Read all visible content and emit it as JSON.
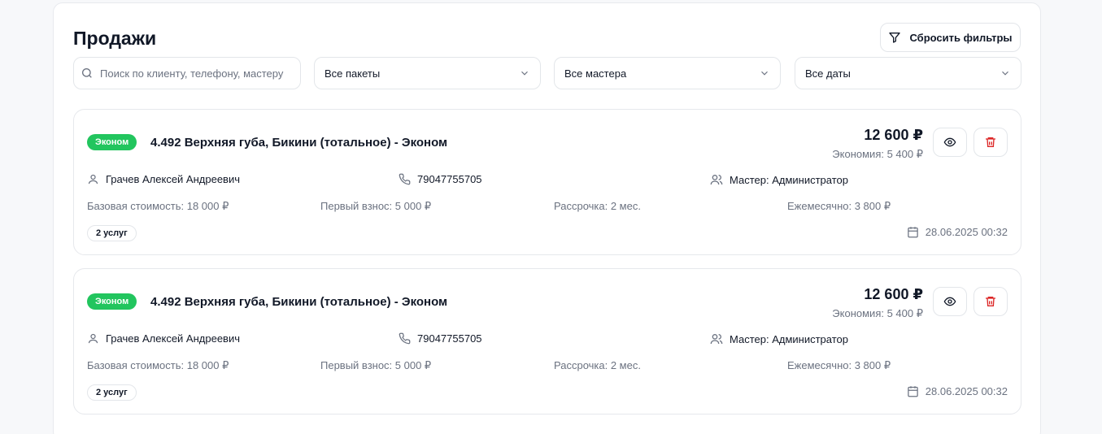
{
  "page": {
    "title": "Продажи"
  },
  "toolbar": {
    "reset_label": "Сбросить фильтры",
    "reset_icon": "filter-icon"
  },
  "filters": {
    "search_placeholder": "Поиск по клиенту, телефону, мастеру",
    "package_selected": "Все пакеты",
    "master_selected": "Все мастера",
    "date_selected": "Все даты"
  },
  "colors": {
    "accent_green": "#22c55e",
    "danger_red": "#dc2626"
  },
  "sales": [
    {
      "badge": "Эконом",
      "title": "4.492 Верхняя губа, Бикини (тотальное) - Эконом",
      "price": "12 600 ₽",
      "savings": "Экономия: 5 400 ₽",
      "client": "Грачев Алексей Андреевич",
      "phone": "79047755705",
      "master": "Мастер: Администратор",
      "base_cost": "Базовая стоимость: 18 000 ₽",
      "first_payment": "Первый взнос: 5 000 ₽",
      "installment": "Рассрочка: 2 мес.",
      "monthly": "Ежемесячно: 3 800 ₽",
      "services": "2 услуг",
      "date": "28.06.2025 00:32"
    },
    {
      "badge": "Эконом",
      "title": "4.492 Верхняя губа, Бикини (тотальное) - Эконом",
      "price": "12 600 ₽",
      "savings": "Экономия: 5 400 ₽",
      "client": "Грачев Алексей Андреевич",
      "phone": "79047755705",
      "master": "Мастер: Администратор",
      "base_cost": "Базовая стоимость: 18 000 ₽",
      "first_payment": "Первый взнос: 5 000 ₽",
      "installment": "Рассрочка: 2 мес.",
      "monthly": "Ежемесячно: 3 800 ₽",
      "services": "2 услуг",
      "date": "28.06.2025 00:32"
    }
  ]
}
